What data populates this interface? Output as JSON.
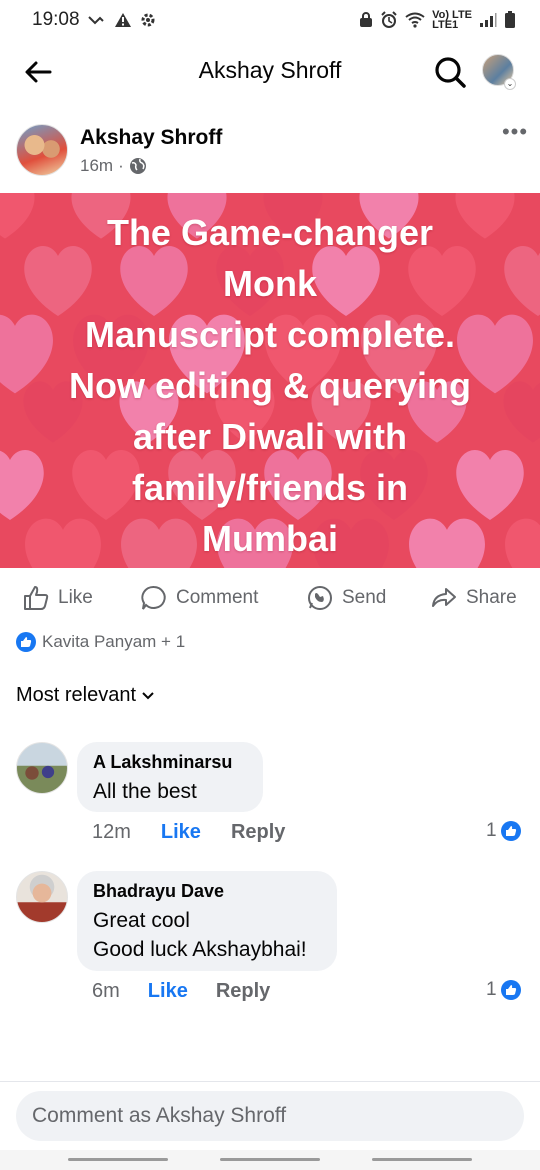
{
  "status_bar": {
    "time": "19:08",
    "network_text_top": "Vo) LTE",
    "network_text_bottom": "LTE1"
  },
  "header": {
    "title": "Akshay Shroff"
  },
  "post": {
    "author": "Akshay Shroff",
    "time": "16m",
    "separator": "·",
    "banner_lines": [
      "The Game-changer",
      "Monk",
      "Manuscript complete.",
      "Now editing & querying",
      "after Diwali with",
      "family/friends in",
      "Mumbai"
    ],
    "banner_color": "#e8495f"
  },
  "actions": {
    "like": "Like",
    "comment": "Comment",
    "send": "Send",
    "share": "Share"
  },
  "reactions": {
    "summary": "Kavita Panyam + 1"
  },
  "sort": {
    "label": "Most relevant"
  },
  "comments": [
    {
      "name": "A Lakshminarsu",
      "text_lines": [
        "All the best"
      ],
      "time": "12m",
      "like": "Like",
      "reply": "Reply",
      "reaction_count": "1"
    },
    {
      "name": "Bhadrayu Dave",
      "text_lines": [
        "Great cool",
        "Good luck Akshaybhai!"
      ],
      "time": "6m",
      "like": "Like",
      "reply": "Reply",
      "reaction_count": "1"
    }
  ],
  "composer": {
    "placeholder": "Comment as Akshay Shroff"
  },
  "colors": {
    "accent": "#1877f2",
    "secondary_text": "#65676b",
    "bubble": "#f0f2f5"
  }
}
